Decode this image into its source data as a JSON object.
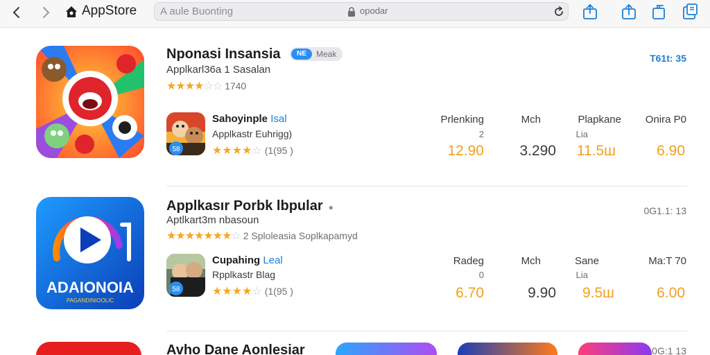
{
  "topbar": {
    "back_icon": "chevron-left-icon",
    "forward_icon": "chevron-right-icon",
    "app_title": "AppStore",
    "url_placeholder": "A aule Buonting",
    "url_text": "opodar",
    "icons": [
      "reload-icon",
      "share-icon",
      "upload-icon",
      "copy-icon",
      "tabs-icon"
    ]
  },
  "rows": [
    {
      "title": "Nponasi Insansia",
      "badge_chip": "NE",
      "badge_label": "Meak",
      "subtitle": "Applkarl36a 1 Sasalan",
      "stars_full": "★★★★",
      "stars_empty": "☆☆",
      "stars_text": "1740",
      "side_text": "T61t: 35",
      "sub": {
        "title_main": "Sahoyinple ",
        "title_accent": "Isal",
        "subtitle": "Applkastr Euhrigg)",
        "badge": "58",
        "stars_full": "★★★★",
        "stars_empty": "☆",
        "stars_text": "(1(95 )"
      },
      "stats": [
        {
          "label": "Prlenking",
          "label2": "2",
          "value": "12.90",
          "color": "#f0a01e"
        },
        {
          "label": "Mch",
          "label2": "",
          "value": "3.290",
          "color": "#3a3a3c"
        },
        {
          "label": "Plapkane",
          "label2": "Lia",
          "value": "11.5ш",
          "color": "#f0a01e"
        },
        {
          "label": "Onira P0",
          "label2": "",
          "value": "6.90",
          "color": "#f0a01e"
        }
      ]
    },
    {
      "title": "Applkasır Porbk lbpular",
      "badge_chip": "",
      "badge_label": "",
      "subtitle": "Aptlkart3m nbasoun",
      "stars_full": "★★★★★★★",
      "stars_empty": "☆",
      "stars_text": "2 Sploleasia Soplkapamyd",
      "side_text": "0G1.1: 13",
      "icon_text": "ADAIONOIA",
      "icon_subtext": "PAGANDINIOOLIC",
      "sub": {
        "title_main": "Cupahing ",
        "title_accent": "Leal",
        "subtitle": "Rpplkastr Blag",
        "badge": "58",
        "stars_full": "★★★★",
        "stars_empty": "☆",
        "stars_text": "(1(95 )"
      },
      "stats": [
        {
          "label": "Radeg",
          "label2": "0",
          "value": "6.70",
          "color": "#f0a01e"
        },
        {
          "label": "Mch",
          "label2": "",
          "value": "9.90",
          "color": "#3a3a3c"
        },
        {
          "label": "Sane",
          "label2": "Lia",
          "value": "9.5ш",
          "color": "#f0a01e"
        },
        {
          "label": "Ma:T 70",
          "label2": "",
          "value": "6.00",
          "color": "#f0a01e"
        }
      ]
    },
    {
      "title": "Avho Dane Aonlesiar",
      "side_text": "0G:1 13"
    }
  ]
}
